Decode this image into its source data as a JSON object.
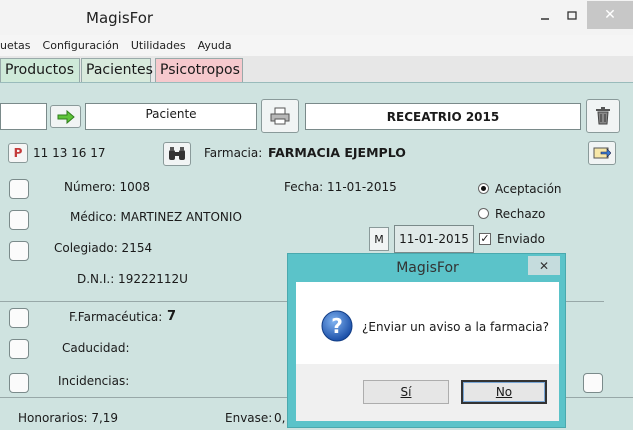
{
  "window": {
    "title": "MagisFor"
  },
  "menu": [
    "uetas",
    "Configuración",
    "Utilidades",
    "Ayuda"
  ],
  "tabs": [
    "Productos",
    "Pacientes",
    "Psicotropos"
  ],
  "toolbar": {
    "paciente_label": "Paciente",
    "receta_title": "RECEATRIO 2015"
  },
  "header": {
    "p_badge": "P",
    "codes": "11 13 16 17",
    "farmacia_label": "Farmacia:",
    "farmacia_value": "FARMACIA EJEMPLO"
  },
  "form": {
    "numero": "Número: 1008",
    "fecha": "Fecha: 11-01-2015",
    "medico": "Médico: MARTINEZ ANTONIO",
    "colegiado": "Colegiado: 2154",
    "dni": "D.N.I.: 19222112U",
    "m_label": "M",
    "date_field": "11-01-2015",
    "status": {
      "aceptacion": "Aceptación",
      "rechazo": "Rechazo",
      "enviado": "Enviado",
      "selected": "aceptacion",
      "enviado_checked": true
    },
    "farmaceutica_label": "F.Farmacéutica:",
    "farmaceutica_value": "7",
    "caducidad": "Caducidad:",
    "incidencias": "Incidencias:",
    "honorarios": "Honorarios: 7,19",
    "envase": "Envase:",
    "envase_value": "0,"
  },
  "dialog": {
    "title": "MagisFor",
    "message": "¿Enviar un aviso a la farmacia?",
    "yes": "Sí",
    "no": "No"
  }
}
